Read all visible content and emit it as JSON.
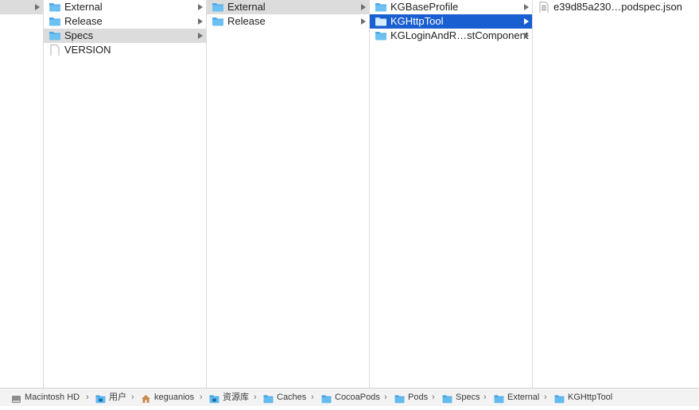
{
  "columns": [
    {
      "items": [
        {
          "label": "",
          "kind": "blank",
          "chevron": true,
          "selected": "gray"
        }
      ]
    },
    {
      "items": [
        {
          "label": "External",
          "kind": "folder",
          "chevron": true,
          "selected": ""
        },
        {
          "label": "Release",
          "kind": "folder",
          "chevron": true,
          "selected": ""
        },
        {
          "label": "Specs",
          "kind": "folder",
          "chevron": true,
          "selected": "gray"
        },
        {
          "label": "VERSION",
          "kind": "document",
          "chevron": false,
          "selected": ""
        }
      ]
    },
    {
      "items": [
        {
          "label": "External",
          "kind": "folder",
          "chevron": true,
          "selected": "gray"
        },
        {
          "label": "Release",
          "kind": "folder",
          "chevron": true,
          "selected": ""
        }
      ]
    },
    {
      "items": [
        {
          "label": "KGBaseProfile",
          "kind": "folder",
          "chevron": true,
          "selected": ""
        },
        {
          "label": "KGHttpTool",
          "kind": "folder",
          "chevron": true,
          "selected": "blue"
        },
        {
          "label": "KGLoginAndR…stComponent",
          "kind": "folder",
          "chevron": true,
          "selected": ""
        }
      ]
    },
    {
      "items": [
        {
          "label": "e39d85a230…podspec.json",
          "kind": "json-file",
          "chevron": false,
          "selected": ""
        }
      ]
    }
  ],
  "path_bar": [
    {
      "label": "Macintosh HD",
      "icon": "hard-drive-icon"
    },
    {
      "label": "用户",
      "icon": "users-folder-icon"
    },
    {
      "label": "keguanios",
      "icon": "home-icon"
    },
    {
      "label": "资源库",
      "icon": "library-folder-icon"
    },
    {
      "label": "Caches",
      "icon": "folder-icon"
    },
    {
      "label": "CocoaPods",
      "icon": "folder-icon"
    },
    {
      "label": "Pods",
      "icon": "folder-icon"
    },
    {
      "label": "Specs",
      "icon": "folder-icon"
    },
    {
      "label": "External",
      "icon": "folder-icon"
    },
    {
      "label": "KGHttpTool",
      "icon": "folder-icon"
    }
  ],
  "colors": {
    "selection_blue": "#1a5fd1",
    "selection_gray": "#dcdcdc",
    "folder_blue": "#5fb6ec"
  }
}
